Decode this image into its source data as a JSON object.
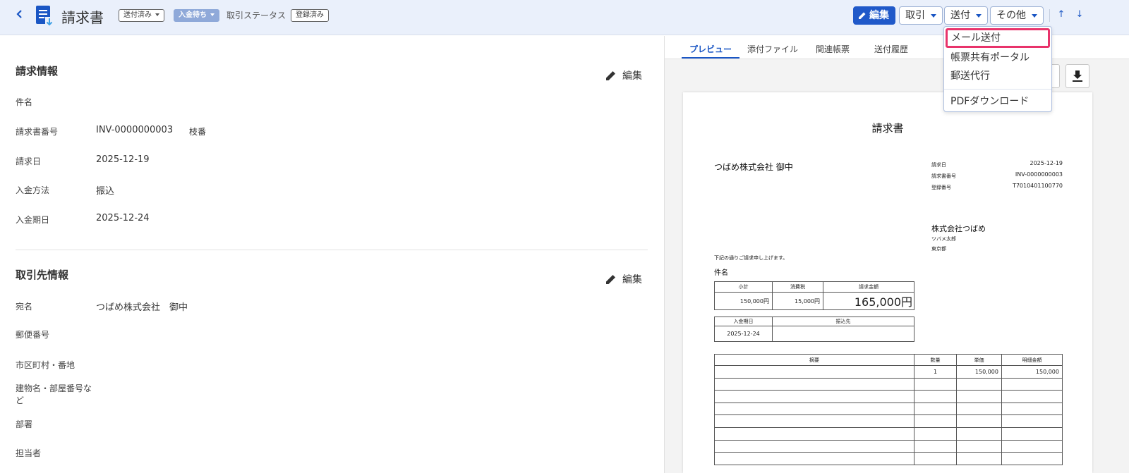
{
  "header": {
    "title": "請求書",
    "chips": [
      "送付済み",
      "入金待ち"
    ],
    "status_label": "取引ステータス",
    "registered": "登録済み",
    "buttons": {
      "edit": "編集",
      "deal": "取引",
      "send": "送付",
      "other": "その他"
    },
    "up": "↑",
    "down": "↓"
  },
  "invoice_info": {
    "title": "請求情報",
    "edit": "編集",
    "fields": {
      "subject_label": "件名",
      "number_label": "請求書番号",
      "number_value": "INV-0000000003",
      "branch_label": "枝番",
      "date_label": "請求日",
      "date_value": "2025-12-19",
      "method_label": "入金方法",
      "method_value": "振込",
      "due_label": "入金期日",
      "due_value": "2025-12-24"
    }
  },
  "partner_info": {
    "title": "取引先情報",
    "edit": "編集",
    "fields": {
      "name_label": "宛名",
      "name_value": "つばめ株式会社　御中",
      "zip_label": "郵便番号",
      "city_label": "市区町村・番地",
      "building_label_1": "建物名・部屋番号な",
      "building_label_2": "ど",
      "dept_label": "部署",
      "person_label": "担当者"
    }
  },
  "tabs": [
    "プレビュー",
    "添付ファイル",
    "関連帳票",
    "送付履歴"
  ],
  "menu": {
    "items": [
      "メール送付",
      "帳票共有ポータル",
      "郵送代行",
      "PDFダウンロード"
    ]
  },
  "preview": {
    "title": "請求書",
    "client": "つばめ株式会社 御中",
    "meta": [
      {
        "label": "請求日",
        "value": "2025-12-19"
      },
      {
        "label": "請求書番号",
        "value": "INV-0000000003"
      },
      {
        "label": "登録番号",
        "value": "T7010401100770"
      }
    ],
    "company": "株式会社つばめ",
    "person": "ツバメ太郎",
    "place": "東京都",
    "intro": "下記の通りご請求申し上げます。",
    "subject": "件名",
    "summary_headers": [
      "小計",
      "消費税",
      "請求金額"
    ],
    "summary_values": [
      "150,000円",
      "15,000円",
      "165,000円"
    ],
    "pay_headers": [
      "入金期日",
      "振込先"
    ],
    "pay_values": [
      "2025-12-24",
      ""
    ],
    "line_headers": [
      "摘要",
      "数量",
      "単価",
      "明細金額"
    ],
    "line_first": [
      "",
      "1",
      "150,000",
      "150,000"
    ]
  }
}
